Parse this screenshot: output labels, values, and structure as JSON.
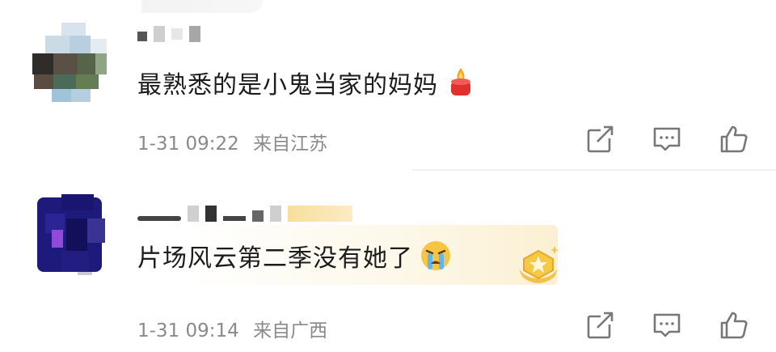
{
  "comments": [
    {
      "text": "最熟悉的是小鬼当家的妈妈",
      "emoji": "candle-emoji",
      "date": "1-31 09:22",
      "location": "来自江苏"
    },
    {
      "text": "片场风云第二季没有她了",
      "emoji": "crying-emoji",
      "date": "1-31 09:14",
      "location": "来自广西"
    }
  ],
  "colors": {
    "text": "#1c1c1c",
    "meta": "#8a8a8a",
    "icon": "#777777",
    "badge_gold": "#f2c14e"
  },
  "icons": [
    "share-icon",
    "reply-icon",
    "like-icon"
  ]
}
